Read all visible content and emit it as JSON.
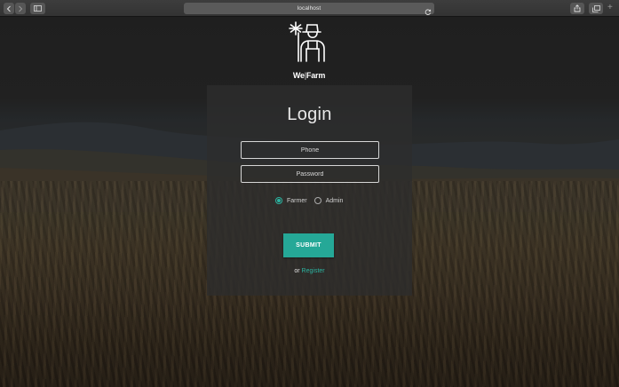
{
  "browser": {
    "url": "localhost"
  },
  "logo": {
    "brand_left": "We",
    "brand_sep": "|",
    "brand_right": "Farm"
  },
  "login": {
    "title": "Login",
    "phone_placeholder": "Phone",
    "password_placeholder": "Password",
    "roles": [
      {
        "label": "Farmer",
        "selected": true
      },
      {
        "label": "Admin",
        "selected": false
      }
    ],
    "submit_label": "SUBMIT",
    "register_prefix": "or",
    "register_label": "Register"
  },
  "colors": {
    "accent": "#25a897",
    "card": "#2d2d2d"
  }
}
